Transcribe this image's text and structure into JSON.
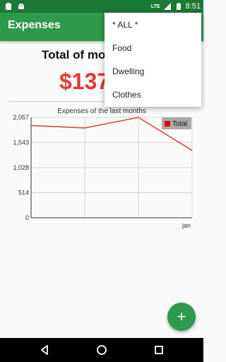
{
  "status_bar": {
    "time": "8:51",
    "network": "LTE",
    "icons": [
      "notification-icon",
      "android-icon",
      "signal-icon",
      "battery-icon"
    ]
  },
  "app_bar": {
    "title": "Expenses"
  },
  "summary": {
    "label": "Total of month",
    "amount": "$137"
  },
  "chart_data": {
    "type": "line",
    "title": "Expenses of the last months",
    "x_categories": [
      "",
      "",
      "",
      "jan"
    ],
    "y_ticks": [
      "2,057",
      "1,543",
      "1,028",
      "514",
      "0"
    ],
    "ylim": [
      0,
      2057
    ],
    "series": [
      {
        "name": "Total",
        "color": "#e53935",
        "values": [
          1890,
          1840,
          2057,
          1380
        ]
      }
    ],
    "legend_position": "top-right",
    "grid": true
  },
  "dropdown": {
    "items": [
      "* ALL *",
      "Food",
      "Dwelling",
      "Clothes"
    ]
  },
  "fab": {
    "label": "+"
  },
  "colors": {
    "primary": "#2e9a4b",
    "primary_dark": "#1b7a33",
    "accent_red": "#e53935"
  }
}
